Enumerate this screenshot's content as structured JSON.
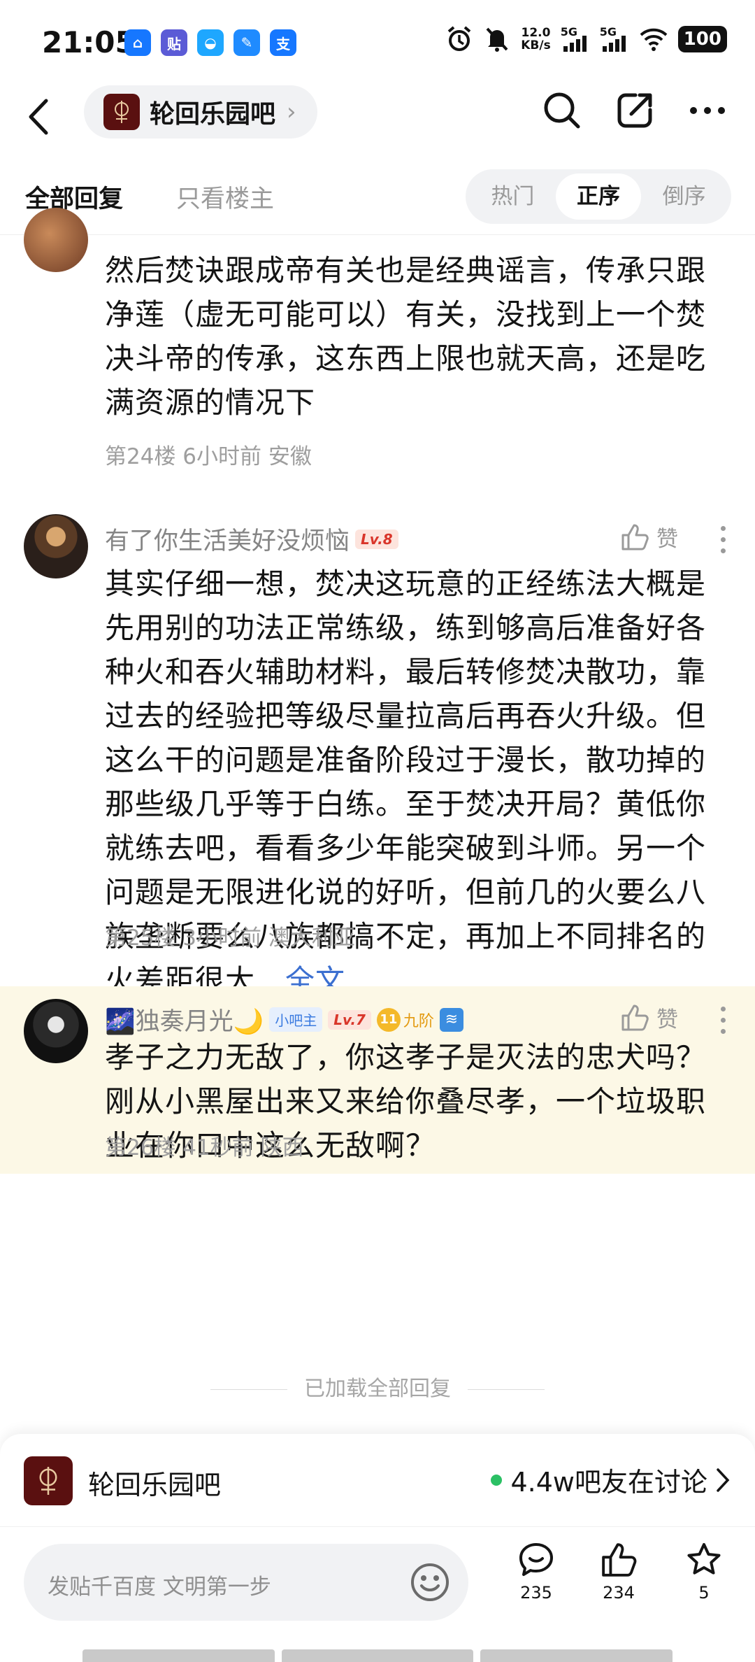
{
  "status_bar": {
    "time": "21:05",
    "apps": [
      {
        "icon": "app-icon-1",
        "glyph": "⌂",
        "color": "#1677ff"
      },
      {
        "icon": "app-icon-2",
        "glyph": "贴",
        "color": "#5b5bd6"
      },
      {
        "icon": "app-icon-3",
        "glyph": "◒",
        "color": "#1ea7ff"
      },
      {
        "icon": "app-icon-4",
        "glyph": "✎",
        "color": "#1f8bff"
      },
      {
        "icon": "alipay-icon",
        "glyph": "支",
        "color": "#1677ff"
      }
    ],
    "net_speed_value": "12.0",
    "net_speed_unit": "KB/s",
    "signal_1": "5G",
    "signal_2": "5G",
    "battery": "100"
  },
  "nav": {
    "forum_name": "轮回乐园吧",
    "arrow": "›"
  },
  "filter": {
    "all_replies": "全部回复",
    "op_only": "只看楼主",
    "sort_hot": "热门",
    "sort_asc": "正序",
    "sort_desc": "倒序"
  },
  "replies": [
    {
      "content": "然后焚诀跟成帝有关也是经典谣言，传承只跟净莲（虚无可能可以）有关，没找到上一个焚决斗帝的传承，这东西上限也就天高，还是吃满资源的情况下",
      "meta": "第24楼 6小时前 安徽"
    },
    {
      "username": "有了你生活美好没烦恼",
      "level": "Lv.8",
      "like_label": "赞",
      "content": "其实仔细一想，焚决这玩意的正经练法大概是先用别的功法正常练级，练到够高后准备好各种火和吞火辅助材料，最后转修焚决散功，靠过去的经验把等级尽量拉高后再吞火升级。但这么干的问题是准备阶段过于漫长，散功掉的那些级几乎等于白练。至于焚决开局？黄低你就练去吧，看看多少年能突破到斗师。另一个问题是无限进化说的好听，但前几的火要么八族垄断要么八族都搞不定，再加上不同排名的火差距很大…",
      "full_text_label": "全文",
      "meta": "第25楼 3小时前 澳大利亚"
    },
    {
      "username": "独奏月光",
      "username_prefix": "🌌",
      "username_suffix": "🌙",
      "admin_badge": "小吧主",
      "level": "Lv.7",
      "rank_number": "11",
      "rank_label": "九阶",
      "like_label": "赞",
      "content": "孝子之力无敌了，你这孝子是灭法的忠犬吗？刚从小黑屋出来又来给你叠尽孝，一个垃圾职业在你口中这么无敌啊？",
      "meta": "第26楼 41秒前 陕西",
      "highlight_color": "#fcf8e6"
    }
  ],
  "loaded_all": "已加载全部回复",
  "forum_card": {
    "name": "轮回乐园吧",
    "discussion": "4.4w吧友在讨论"
  },
  "action_bar": {
    "placeholder": "发贴千百度 文明第一步",
    "comments": "235",
    "likes": "234",
    "favorites": "5"
  }
}
